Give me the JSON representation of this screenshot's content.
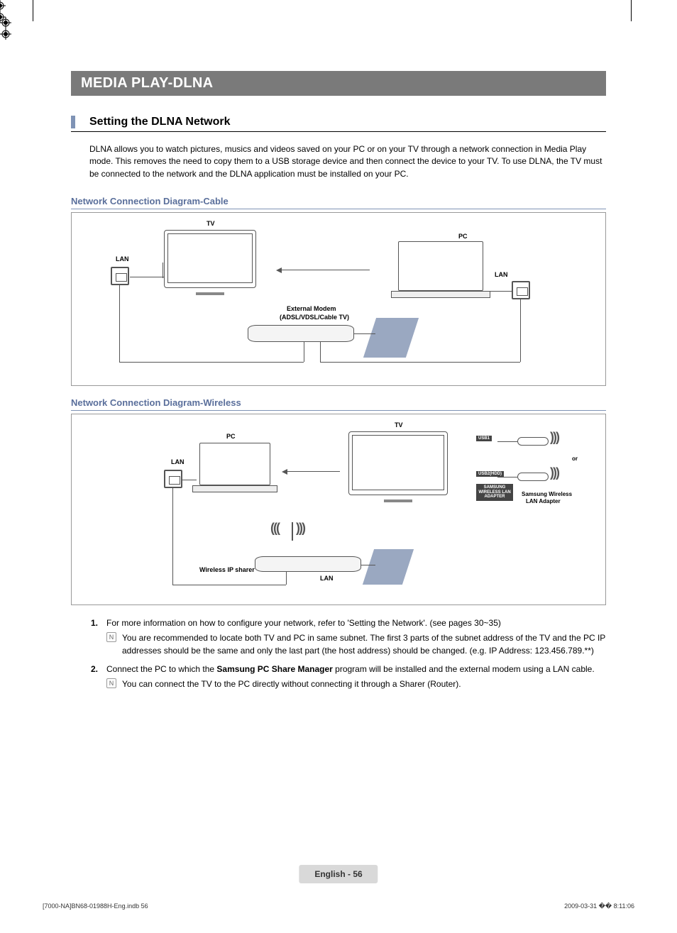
{
  "header": {
    "title": "MEDIA PLAY-DLNA"
  },
  "section": {
    "title": "Setting the DLNA Network"
  },
  "intro": "DLNA allows you to watch pictures, musics and videos saved on your PC or on your TV through a network connection in Media Play mode. This removes the need to copy them to a USB storage device and then connect the device to your TV. To use DLNA, the TV must be connected to the network and the DLNA application must be installed on your PC.",
  "diagram_cable": {
    "heading": "Network Connection Diagram-Cable",
    "labels": {
      "tv": "TV",
      "pc": "PC",
      "lan_left": "LAN",
      "lan_right": "LAN",
      "modem_title": "External Modem",
      "modem_sub": "(ADSL/VDSL/Cable TV)"
    }
  },
  "diagram_wireless": {
    "heading": "Network Connection Diagram-Wireless",
    "labels": {
      "tv": "TV",
      "pc": "PC",
      "lan_left": "LAN",
      "lan_bottom": "LAN",
      "or": "or",
      "adapter_title": "Samsung Wireless",
      "adapter_sub": "LAN Adapter",
      "sharer": "Wireless IP sharer",
      "panel_usb1": "USB1",
      "panel_usb2hdd": "USB2(HDD)",
      "panel_lanbox": "SAMSUNG\nWIRELESS LAN\nADAPTER"
    }
  },
  "steps": {
    "1": {
      "text": "For more information on how to configure your network, refer to 'Setting the Network'. (see pages 30~35)",
      "note": "You are recommended to locate both TV and PC in same subnet. The first 3 parts of the subnet address of the TV and the PC IP addresses should be the same and only the last part (the host address) should be changed. (e.g. IP Address: 123.456.789.**)"
    },
    "2": {
      "text_before": "Connect the PC to which the ",
      "text_bold": "Samsung PC Share Manager",
      "text_after": " program will be installed and the external modem using a LAN cable.",
      "note": "You can connect the TV to the PC directly without connecting it through a Sharer (Router)."
    }
  },
  "footer": {
    "page_label": "English - 56"
  },
  "print_meta": {
    "left": "[7000-NA]BN68-01988H-Eng.indb   56",
    "right": "2009-03-31   �� 8:11:06"
  },
  "note_icon_glyph": "N"
}
